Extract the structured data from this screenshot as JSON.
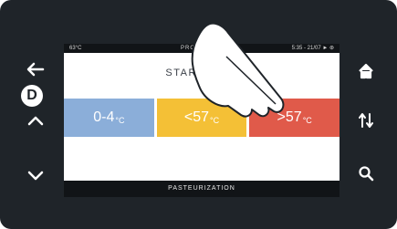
{
  "status_bar": {
    "temperature": "63°C",
    "program": "PRO",
    "datetime": "5:35 - 21/07"
  },
  "screen": {
    "subtitle": "STARTING T",
    "footer": "PASTEURIZATION"
  },
  "tiles": [
    {
      "value": "0-4",
      "unit": "°C",
      "color": "#8baed9"
    },
    {
      "value": "<57",
      "unit": "°C",
      "color": "#f4c036"
    },
    {
      "value": ">57",
      "unit": "°C",
      "color": "#e05a4a"
    }
  ],
  "left_icons": [
    "back-arrow-icon",
    "up-chevron-icon",
    "down-chevron-icon"
  ],
  "right_icons": [
    "home-icon",
    "sort-icon",
    "search-icon"
  ],
  "badge": "D"
}
